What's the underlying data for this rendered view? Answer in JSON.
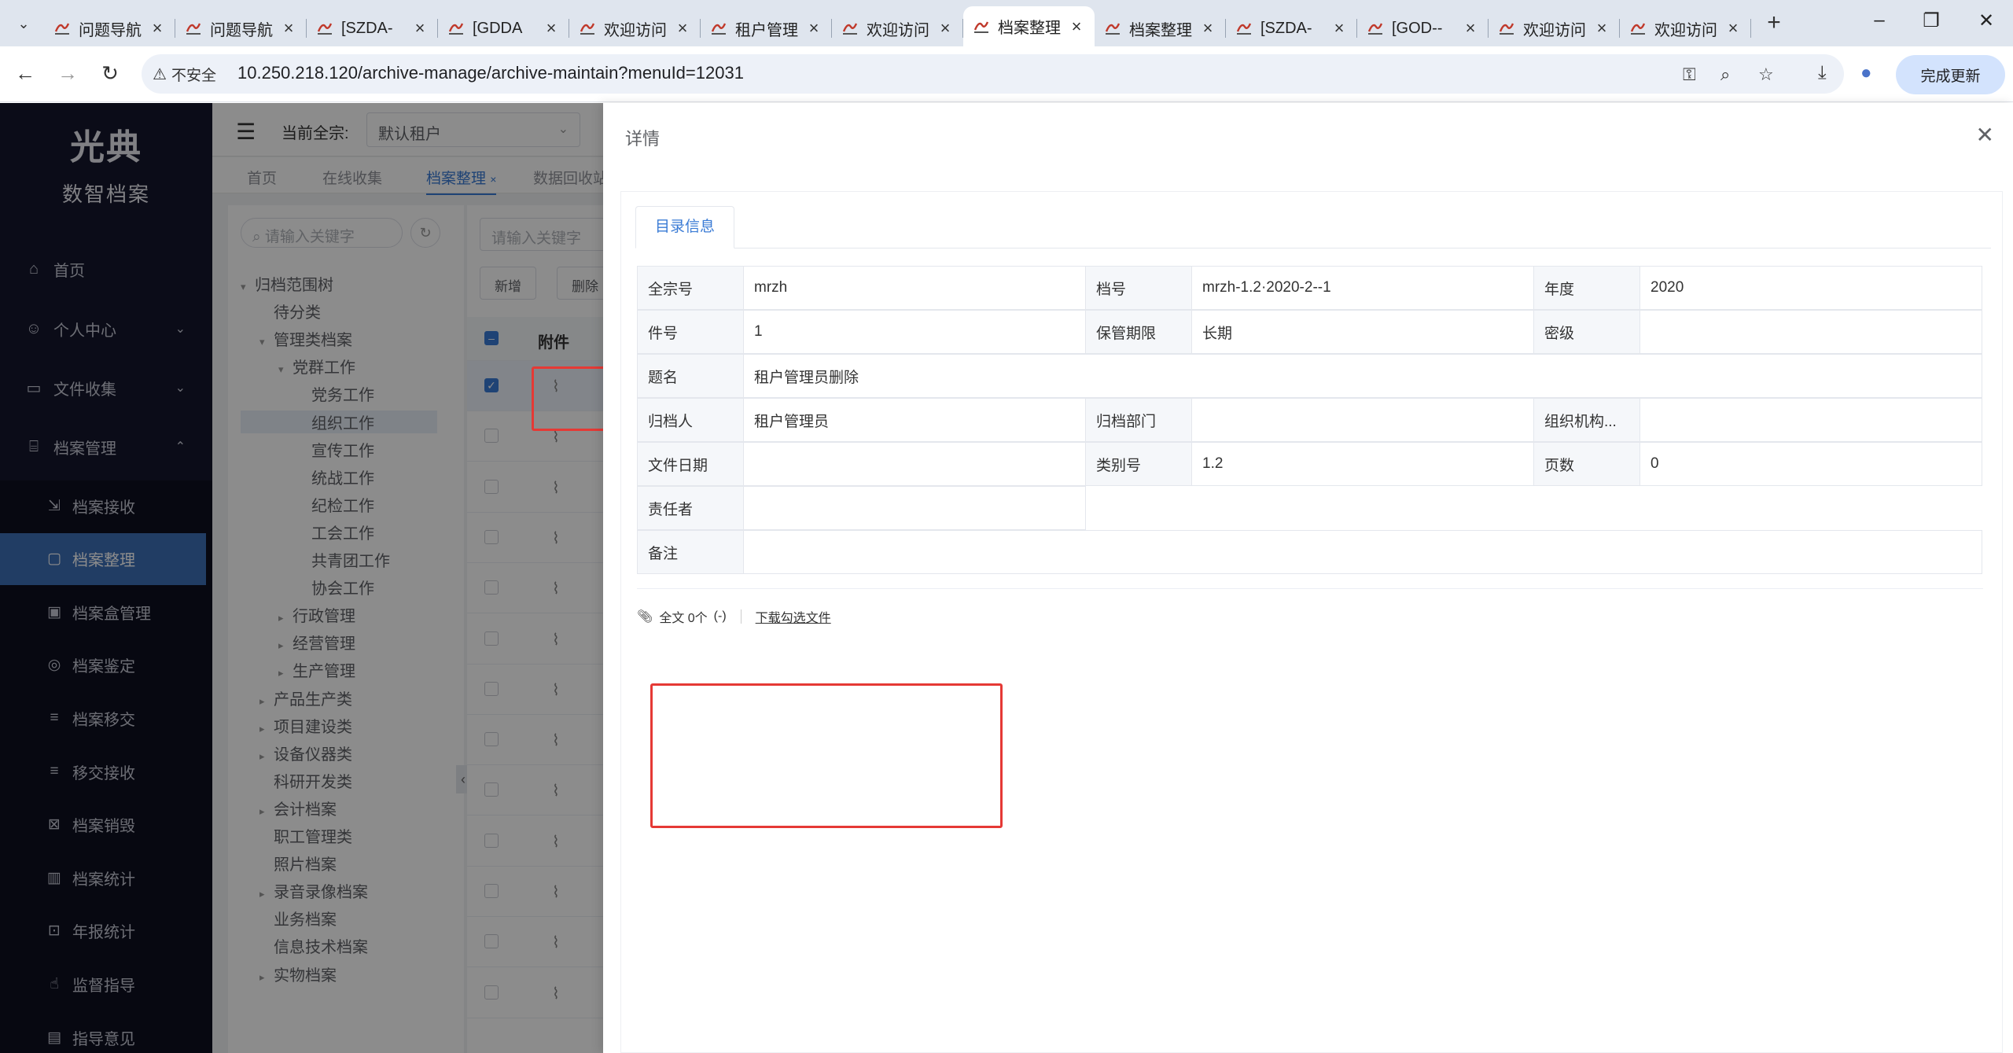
{
  "browser": {
    "tabs": [
      {
        "title": "问题导航"
      },
      {
        "title": "问题导航"
      },
      {
        "title": "[SZDA-"
      },
      {
        "title": "[GDDA"
      },
      {
        "title": "欢迎访问"
      },
      {
        "title": "租户管理"
      },
      {
        "title": "欢迎访问"
      },
      {
        "title": "档案整理",
        "active": true
      },
      {
        "title": "档案整理"
      },
      {
        "title": "[SZDA-"
      },
      {
        "title": "[GOD--"
      },
      {
        "title": "欢迎访问"
      },
      {
        "title": "欢迎访问"
      }
    ],
    "not_secure_label": "不安全",
    "url": "10.250.218.120/archive-manage/archive-maintain?menuId=12031",
    "update_label": "完成更新",
    "accent": "#d3e3fd"
  },
  "sidebar": {
    "logo_text": "光典",
    "app_name": "数智档案",
    "menu": [
      {
        "label": "首页",
        "icon": "home-icon"
      },
      {
        "label": "个人中心",
        "icon": "user-icon"
      },
      {
        "label": "文件收集",
        "icon": "briefcase-icon"
      },
      {
        "label": "档案管理",
        "icon": "bank-icon"
      }
    ],
    "submenu": [
      {
        "label": "档案接收"
      },
      {
        "label": "档案整理",
        "active": true
      },
      {
        "label": "档案盒管理"
      },
      {
        "label": "档案鉴定"
      },
      {
        "label": "档案移交"
      },
      {
        "label": "移交接收"
      },
      {
        "label": "档案销毁"
      },
      {
        "label": "档案统计"
      },
      {
        "label": "年报统计"
      },
      {
        "label": "监督指导"
      },
      {
        "label": "指导意见"
      }
    ]
  },
  "header": {
    "current_tenant_label": "当前全宗:",
    "tenant_value": "默认租户"
  },
  "tags": {
    "items": [
      "首页",
      "在线收集",
      "档案整理",
      "数据回收站"
    ]
  },
  "tree": {
    "search_placeholder": "请输入关键字",
    "nodes": [
      "归档范围树",
      "待分类",
      "管理类档案",
      "党群工作",
      "党务工作",
      "组织工作",
      "宣传工作",
      "统战工作",
      "纪检工作",
      "工会工作",
      "共青团工作",
      "协会工作",
      "行政管理",
      "经营管理",
      "生产管理",
      "产品生产类",
      "项目建设类",
      "设备仪器类",
      "科研开发类",
      "会计档案",
      "职工管理类",
      "照片档案",
      "录音录像档案",
      "业务档案",
      "信息技术档案",
      "实物档案"
    ]
  },
  "list": {
    "search_placeholder": "请输入关键字",
    "add_label": "新增",
    "delete_label": "删除",
    "col_attachment": "附件"
  },
  "drawer": {
    "title": "详情",
    "tab_label": "目录信息",
    "fields": {
      "quanzong_label": "全宗号",
      "quanzong_value": "mrzh",
      "danghao_label": "档号",
      "danghao_value": "mrzh-1.2·2020-2--1",
      "niandu_label": "年度",
      "niandu_value": "2020",
      "jianhao_label": "件号",
      "jianhao_value": "1",
      "baoguan_label": "保管期限",
      "baoguan_value": "长期",
      "miji_label": "密级",
      "miji_value": "",
      "timing_label": "题名",
      "timing_value": "租户管理员删除",
      "guidangren_label": "归档人",
      "guidangren_value": "租户管理员",
      "guidangbumen_label": "归档部门",
      "guidangbumen_value": "",
      "zuzhijigou_label": "组织机构...",
      "zuzhijigou_value": "",
      "wenjianriqi_label": "文件日期",
      "wenjianriqi_value": "",
      "leibiehao_label": "类别号",
      "leibiehao_value": "1.2",
      "yeshu_label": "页数",
      "yeshu_value": "0",
      "zerenzhe_label": "责任者",
      "zerenzhe_value": "",
      "beizhu_label": "备注",
      "beizhu_value": ""
    },
    "fulltext_label": "全文 0个",
    "fulltext_suffix": "(-)",
    "download_label": "下载勾选文件"
  }
}
